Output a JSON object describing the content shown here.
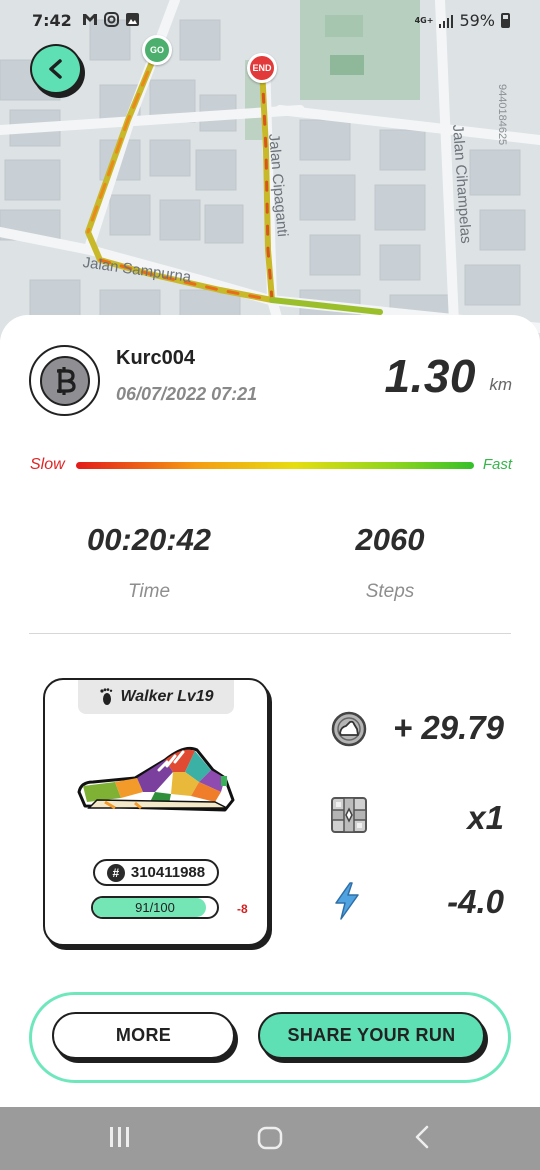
{
  "status_bar": {
    "time": "7:42",
    "network": "4G+",
    "battery": "59%"
  },
  "map": {
    "streets": [
      "Jalan Cipaganti",
      "Jalan Cihampelas",
      "Jalan Sampurna"
    ],
    "map_id": "9440184625",
    "start_label": "GO",
    "end_label": "END"
  },
  "run": {
    "username": "Kurc004",
    "datetime": "06/07/2022 07:21",
    "distance": "1.30",
    "distance_unit": "km",
    "speed_slow_label": "Slow",
    "speed_fast_label": "Fast",
    "time_value": "00:20:42",
    "time_label": "Time",
    "steps_value": "2060",
    "steps_label": "Steps"
  },
  "shoe": {
    "level": "Walker Lv19",
    "id": "310411988",
    "durability_text": "91/100",
    "durability_fraction": 0.91,
    "durability_loss": "-8"
  },
  "rewards": {
    "earned": "+ 29.79",
    "multiplier": "x1",
    "energy": "-4.0"
  },
  "actions": {
    "more_label": "MORE",
    "share_label": "SHARE YOUR RUN"
  },
  "colors": {
    "accent": "#5ee0b4",
    "accent_border": "#6fe7bd",
    "slow": "#e02424",
    "fast": "#35b64a"
  }
}
